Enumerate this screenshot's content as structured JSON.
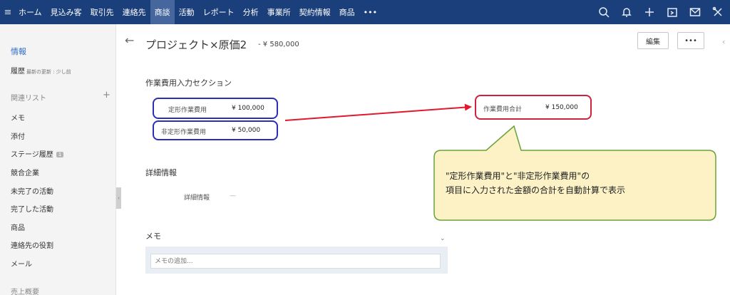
{
  "nav": {
    "menu_icon": "hamburger-icon",
    "items": [
      "ホーム",
      "見込み客",
      "取引先",
      "連絡先",
      "商談",
      "活動",
      "レポート",
      "分析",
      "事業所",
      "契約情報",
      "商品",
      "•••"
    ],
    "active_index": 4,
    "icons": [
      "search-icon",
      "bell-icon",
      "plus-icon",
      "calendar-icon",
      "mail-icon",
      "tools-icon"
    ]
  },
  "sidebar": {
    "info_tab": "情報",
    "history_label": "履歴",
    "history_note": "最新の更新 : 少し前",
    "related_header": "関連リスト",
    "add_symbol": "+",
    "items": [
      "メモ",
      "添付",
      "ステージ履歴",
      "競合企業",
      "未完了の活動",
      "完了した活動",
      "商品",
      "連絡先の役割",
      "メール"
    ],
    "stage_badge": "1",
    "bottom_label": "売上概要",
    "handle_glyph": "‹"
  },
  "record": {
    "back_symbol": "←",
    "title": "プロジェクト×原価2",
    "amount": "- ¥ 580,000",
    "edit_button": "編集",
    "more_button": "•••",
    "edge_chevron": "‹"
  },
  "cost_section": {
    "title": "作業費用入力セクション",
    "fixed_label": "定形作業費用",
    "fixed_value": "¥ 100,000",
    "nonfixed_label": "非定形作業費用",
    "nonfixed_value": "¥ 50,000",
    "total_label": "作業費用合計",
    "total_value": "¥ 150,000"
  },
  "detail_section": {
    "title": "詳細情報",
    "field_label": "詳細情報",
    "field_value": "—"
  },
  "memo_section": {
    "title": "メモ",
    "placeholder": "メモの追加...",
    "chevron": "⌄"
  },
  "callout": {
    "line1": "\"定形作業費用\"と\"非定形作業費用\"の",
    "line2": "項目に入力された金額の合計を自動計算で表示",
    "fill_color": "#fcf2c6",
    "border_color": "#6aa13a"
  },
  "annotations": {
    "oval_blue": "#2b2fb8",
    "oval_red": "#d0213c",
    "arrow_color": "#e3182f"
  },
  "colors": {
    "nav_bg": "#1b3f7a",
    "nav_active": "#45679d",
    "link_blue": "#2f6bc5"
  }
}
